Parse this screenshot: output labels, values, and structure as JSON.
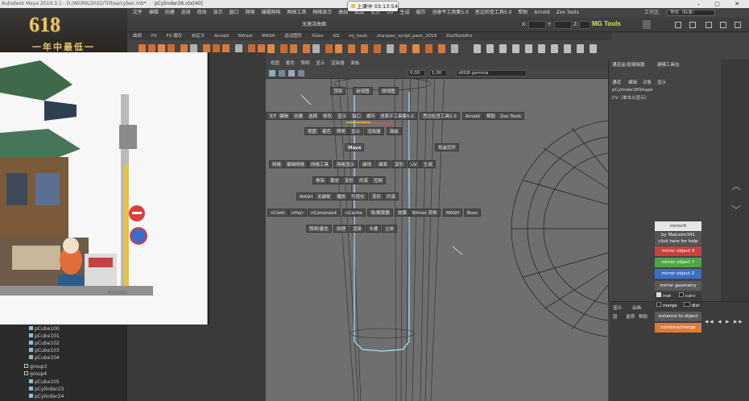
{
  "app": {
    "title": "Autodesk Maya 2019.3.1 - D:/WORK/2022/Tilitea/cybec.mb*",
    "selection_title": "pCylinder26.vtx[40]"
  },
  "recording": {
    "label": "上课中 03:13:54"
  },
  "menubar": {
    "items": [
      "文件",
      "编辑",
      "创建",
      "选择",
      "修改",
      "显示",
      "窗口",
      "网格",
      "编辑网格",
      "网格工具",
      "网格显示",
      "曲线",
      "曲面",
      "变形",
      "UV",
      "生成",
      "缓存",
      "池章平工具集5.0",
      "思边检查工具5.0",
      "帮助",
      "Arnold",
      "Zoo Tools"
    ],
    "workspace_label": "工作区:",
    "workspace_value": "常规（标准）"
  },
  "statusline": {
    "no_live_surface": "无激活曲面",
    "mg_tools": "MG Tools",
    "field_x": "X:",
    "field_y": "Y:",
    "field_z": "Z:"
  },
  "shelf": {
    "tabs": [
      "曲面",
      "FX",
      "FX 缓存",
      "自定义",
      "Arnold",
      "Bifrost",
      "MASH",
      "运动图形",
      "XGen",
      "GS",
      "mj_tools",
      "zhanpan_script_pack_2019",
      "ZooToolsPro"
    ]
  },
  "promo": {
    "number": "618",
    "tagline": "一年中最低一"
  },
  "viewport": {
    "menu": [
      "视图",
      "着色",
      "照明",
      "显示",
      "渲染器",
      "面板"
    ],
    "toolbar_values": [
      "0.00",
      "1.00",
      "sRGB gamma"
    ],
    "hotbox_top": [
      "顶部",
      "前视图",
      "侧视图"
    ],
    "hotbox_rows": [
      [
        "文件",
        "编辑",
        "创建",
        "选择",
        "修改",
        "显示",
        "窗口",
        "缓存",
        "池章平工具集5.0",
        "思边检查工具5.0",
        "Arnold",
        "帮助",
        "Zoo Tools"
      ],
      [
        "视图",
        "着色",
        "照明",
        "显示",
        "渲染器",
        "面板"
      ],
      [
        "Maya",
        "热盒控件"
      ],
      [
        "网格",
        "编辑网格",
        "网格工具",
        "网格显示",
        "曲线",
        "曲面",
        "变形",
        "UV",
        "生成"
      ],
      [
        "骨架",
        "蒙皮",
        "变形",
        "约束",
        "控制"
      ],
      [
        "MASH",
        "关键帧",
        "播放",
        "可视化",
        "变形",
        "约束"
      ],
      [
        "nCloth",
        "nHair",
        "nConstraint",
        "nCache",
        "场/解算器",
        "效果",
        "Bifrost 流体",
        "MASH",
        "Boss"
      ],
      [
        "照明/着色",
        "纹理",
        "渲染",
        "卡通",
        "立体"
      ]
    ]
  },
  "channelbox": {
    "tabs": [
      "通道盒/层编辑器",
      "建模工具包"
    ],
    "menu": [
      "通道",
      "编辑",
      "对象",
      "显示"
    ],
    "object": "pCylinder26Shape",
    "cvs": "CV（单击以显示）"
  },
  "layer_editor": {
    "tabs": [
      "显示",
      "动画"
    ],
    "menu": [
      "层",
      "选项",
      "帮助"
    ]
  },
  "mirror_tool": {
    "title": "mirrorIt",
    "author": "by Malcolm341",
    "help": "click here for help",
    "mirror_x": "mirror object X",
    "mirror_y": "mirror object Y",
    "mirror_z": "mirror object Z",
    "mirror_geo": "mirror geometry",
    "inst": "inst",
    "cut": "cut+",
    "merge": "merge",
    "dist": "dist",
    "instance_to_object": "instance to object",
    "combine_merge": "combine/merge",
    "colors": {
      "x": "#c8413c",
      "y": "#52a447",
      "z": "#3c6fc8",
      "combine": "#e07a35"
    }
  },
  "outliner": {
    "items": [
      {
        "name": "pCube100",
        "kind": "mesh"
      },
      {
        "name": "pCube101",
        "kind": "mesh"
      },
      {
        "name": "pCube102",
        "kind": "mesh"
      },
      {
        "name": "pCube103",
        "kind": "mesh"
      },
      {
        "name": "pCube104",
        "kind": "mesh"
      },
      {
        "name": "group3",
        "kind": "group"
      },
      {
        "name": "group4",
        "kind": "group"
      },
      {
        "name": "pCube105",
        "kind": "mesh"
      },
      {
        "name": "pCylinder23",
        "kind": "mesh"
      },
      {
        "name": "pCylinder24",
        "kind": "mesh"
      }
    ]
  },
  "reference_image": {
    "signature": "M.Y.2019"
  }
}
